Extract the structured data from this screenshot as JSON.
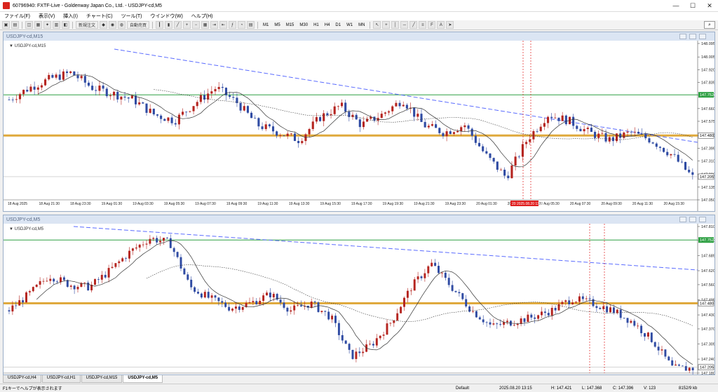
{
  "window": {
    "title": "60796940: FXTF-Live - Goldenway Japan Co., Ltd. - USDJPY-cd,M5"
  },
  "menu": [
    "ファイル(F)",
    "表示(V)",
    "挿入(I)",
    "チャート(C)",
    "ツール(T)",
    "ウインドウ(W)",
    "ヘルプ(H)"
  ],
  "toolbar": {
    "new_order": "新規注文",
    "auto_trading": "自動売買",
    "timeframes": [
      "M1",
      "M5",
      "M15",
      "M30",
      "H1",
      "H4",
      "D1",
      "W1",
      "MN"
    ]
  },
  "chart1": {
    "title": "USDJPY-cd,M15",
    "label": "USDJPY-cd,M15",
    "price_ticks": [
      "148.095",
      "148.005",
      "147.920",
      "147.835",
      "147.750",
      "147.660",
      "147.575",
      "147.480",
      "147.395",
      "147.310",
      "147.220",
      "147.135",
      "147.050"
    ],
    "time_ticks": [
      "18 Aug 2025",
      "18 Aug 21:30",
      "18 Aug 23:30",
      "19 Aug 01:30",
      "19 Aug 03:30",
      "19 Aug 05:30",
      "19 Aug 07:30",
      "19 Aug 09:30",
      "19 Aug 11:30",
      "19 Aug 13:30",
      "19 Aug 15:30",
      "19 Aug 17:30",
      "19 Aug 19:30",
      "19 Aug 21:30",
      "19 Aug 23:30",
      "20 Aug 01:30",
      "20 Aug 03:30",
      "20 Aug 05:30",
      "20 Aug 07:30",
      "20 Aug 09:30",
      "20 Aug 11:30",
      "20 Aug 15:30"
    ],
    "green_level": "147.752",
    "yellow_level": "147.480",
    "current_price": "147.205",
    "marker_label": "20 2025.08.20 13:00"
  },
  "chart2": {
    "title": "USDJPY-cd,M5",
    "label": "USDJPY-cd,M5",
    "price_ticks": [
      "147.810",
      "147.750",
      "147.685",
      "147.620",
      "147.560",
      "147.495",
      "147.430",
      "147.370",
      "147.305",
      "147.240",
      "147.180"
    ],
    "green_level": "147.752",
    "yellow_level": "147.480",
    "current_price": "147.205"
  },
  "tabs": [
    "USDJPY-cd,H4",
    "USDJPY-cd,H1",
    "USDJPY-cd,M15",
    "USDJPY-cd,M5"
  ],
  "status": {
    "help": "F1キーでヘルプが表示されます",
    "profile": "Default",
    "datetime": "2025.08.20 13:15",
    "high": "H: 147.421",
    "low": "L: 147.368",
    "close": "C: 147.396",
    "volume": "V: 123",
    "traffic": "8152/9 kb"
  },
  "colors": {
    "bull": "#b5241f",
    "bear": "#2f4ba3",
    "trend": "#5b6cff",
    "green_line": "#2ea043",
    "yellow_line": "#d99a1a",
    "marker": "#e02020"
  }
}
